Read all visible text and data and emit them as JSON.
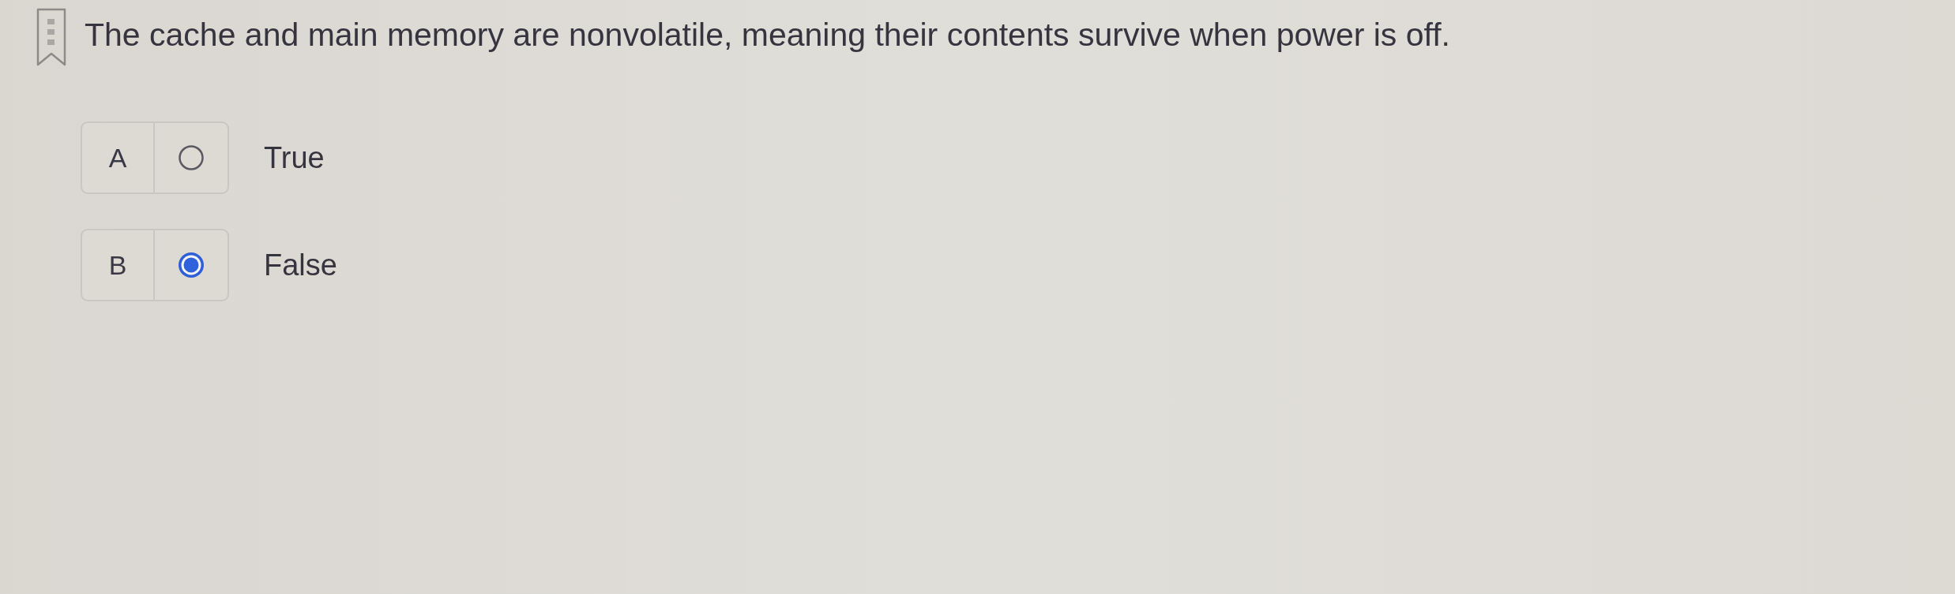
{
  "question": {
    "text": "The cache and main memory are nonvolatile, meaning their contents survive when power is off."
  },
  "options": [
    {
      "letter": "A",
      "label": "True",
      "selected": false
    },
    {
      "letter": "B",
      "label": "False",
      "selected": true
    }
  ]
}
